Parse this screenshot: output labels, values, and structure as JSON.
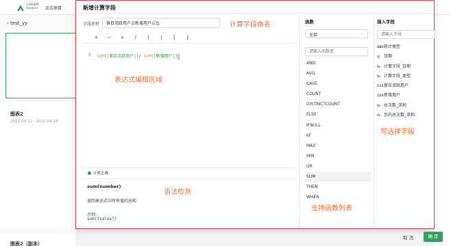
{
  "app": {
    "brand_line1": "CONVERT",
    "brand_line2": "Analytics",
    "project": "正式项目",
    "back_label": "test_yy"
  },
  "background_cards": [
    {
      "title": "图表2",
      "date": "2022-04-12 - 2022-04-18"
    },
    {
      "title": "图表2（副本）"
    }
  ],
  "modal": {
    "title": "新增计算字段",
    "field_name_label": "字段名称",
    "field_name_value": "首日活跃用户占新增用户占比",
    "operators": [
      "+",
      "−",
      "×",
      "/",
      "(",
      ")",
      "[",
      "]"
    ],
    "expression": {
      "line_number": "1",
      "fn1": "SUM",
      "arg1": "[首日活跃用户]",
      "div": ")/ ",
      "fn2": "SUM",
      "arg2": "[新增用户]"
    },
    "validation": "计算正确",
    "syntax": {
      "signature": "sum(number)",
      "description": "返回表达式中所有值的总和",
      "example_label": "示例:",
      "example_code": "sum([sales])"
    },
    "functions": {
      "title": "函数",
      "category": "全部",
      "search_placeholder": "请输入函数名",
      "items": [
        "AND",
        "AVG",
        "CASE",
        "COUNT",
        "DISTINCTCOUNT",
        "ELSE",
        "IFNULL",
        "IIF",
        "MAX",
        "MIN",
        "OR",
        "SUM",
        "THEN",
        "WHEN"
      ],
      "selected": "SUM"
    },
    "fields": {
      "title": "插入字段",
      "search_placeholder": "请输入字段",
      "items": [
        {
          "icon": "ABC",
          "label": "统计类型"
        },
        {
          "icon": "▤",
          "label": "日期"
        },
        {
          "icon": "fx",
          "label": "计算字段_日期"
        },
        {
          "icon": "fx",
          "label": "计算字段_类型"
        },
        {
          "icon": "123",
          "label": "首日活跃用户"
        },
        {
          "icon": "123",
          "label": "新增用户"
        },
        {
          "icon": "fx",
          "label": "总次数_求和"
        },
        {
          "icon": "fx",
          "label": "负的总次数_求和"
        }
      ]
    },
    "annotations": {
      "field_name": "计算字段命名",
      "editor": "表达式编辑区域",
      "syntax": "语法检测",
      "functions": "支持函数列表",
      "fields": "可选择字段"
    }
  },
  "footer": {
    "cancel": "取 消",
    "confirm": "确 定"
  },
  "colors": {
    "accent": "#2fa35a",
    "annotation": "#f56c2c",
    "highlight_border": "#e23d3d",
    "keyword": "#e6913b",
    "field": "#2f9a3b"
  }
}
